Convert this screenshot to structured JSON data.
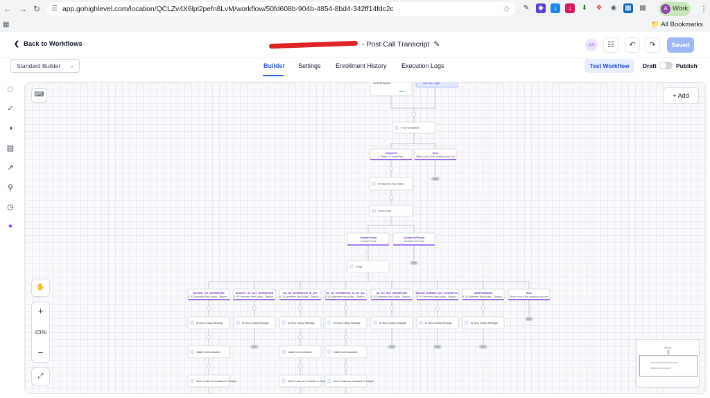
{
  "browser": {
    "url": "app.gohighlevel.com/location/QCLZv4X6lpl2pefn8LvM/workflow/50fd608b-904b-4854-8bd4-342ff14fdc2c",
    "profile_label": "Work",
    "profile_initial": "A",
    "all_bookmarks": "All Bookmarks"
  },
  "header": {
    "back_label": "Back to Workflows",
    "title_suffix": "- Post Call Transcript",
    "avatar_initials": "AB",
    "saved_label": "Saved"
  },
  "tabs": {
    "builder_select": "Standard Builder",
    "items": [
      "Builder",
      "Settings",
      "Enrollment History",
      "Execution Logs"
    ],
    "test_workflow": "Test Workflow",
    "draft": "Draft",
    "publish": "Publish"
  },
  "canvas": {
    "add_label": "Add",
    "zoom": "43%",
    "top_partial": {
      "left_line": "No items applied",
      "left_edit": "Save",
      "right_title": "Add New Trigger"
    },
    "call_node": "If Call Completed",
    "branch1": {
      "completed_title": "Completed",
      "completed_sub": "If \"Status\" is \"completed\"",
      "none_title": "None",
      "none_sub": "When none of the conditions are met"
    },
    "determine_node": "AI Determine Next Action",
    "find_contact": "Find Contact",
    "contact_branches": {
      "found_title": "Contact Found",
      "found_sub": "Contact Found",
      "notfound_title": "Contact Not Found",
      "notfound_sub": "Contact Not Found"
    },
    "ifelse_node": "If Else",
    "end_label": "END",
    "branches": [
      {
        "title": "BOUGHT_HIT_INTERESTED",
        "sub": "If \"AI Determine Next Action - Respon..."
      },
      {
        "title": "BOUGHT_HIT_NOT_INTERESTED",
        "sub": "If \"AI Determine Next Action - Respon..."
      },
      {
        "title": "NO_HIT_INTERESTED_IN_APT",
        "sub": "If \"AI Determine Next Action - Respon..."
      },
      {
        "title": "NO_HIT_INTERESTED_IN_HIT_AS...",
        "sub": "If \"AI Determine Next Action - Respon..."
      },
      {
        "title": "NO_HIT_NOT_INTERESTED",
        "sub": "If \"AI Determine Next Action - Respon..."
      },
      {
        "title": "WRONG_NUMBER_NOT_INTERESTE...",
        "sub": "If \"AI Determine Next Action - Respon..."
      },
      {
        "title": "UNDETERMINED",
        "sub": "If \"AI Determine Next Action - Respon..."
      },
      {
        "title": "None",
        "sub": "When none of the conditions are met"
      }
    ],
    "send_message": "AI Send Chatup Message",
    "initiate": "Initiate Communication",
    "mark_contact": "Mark Contact as Contacted in Hubspot"
  },
  "colors": {
    "accent": "#2563eb",
    "purple": "#7c3aed",
    "saved": "#9fb7f5",
    "redaction": "#e02424"
  }
}
